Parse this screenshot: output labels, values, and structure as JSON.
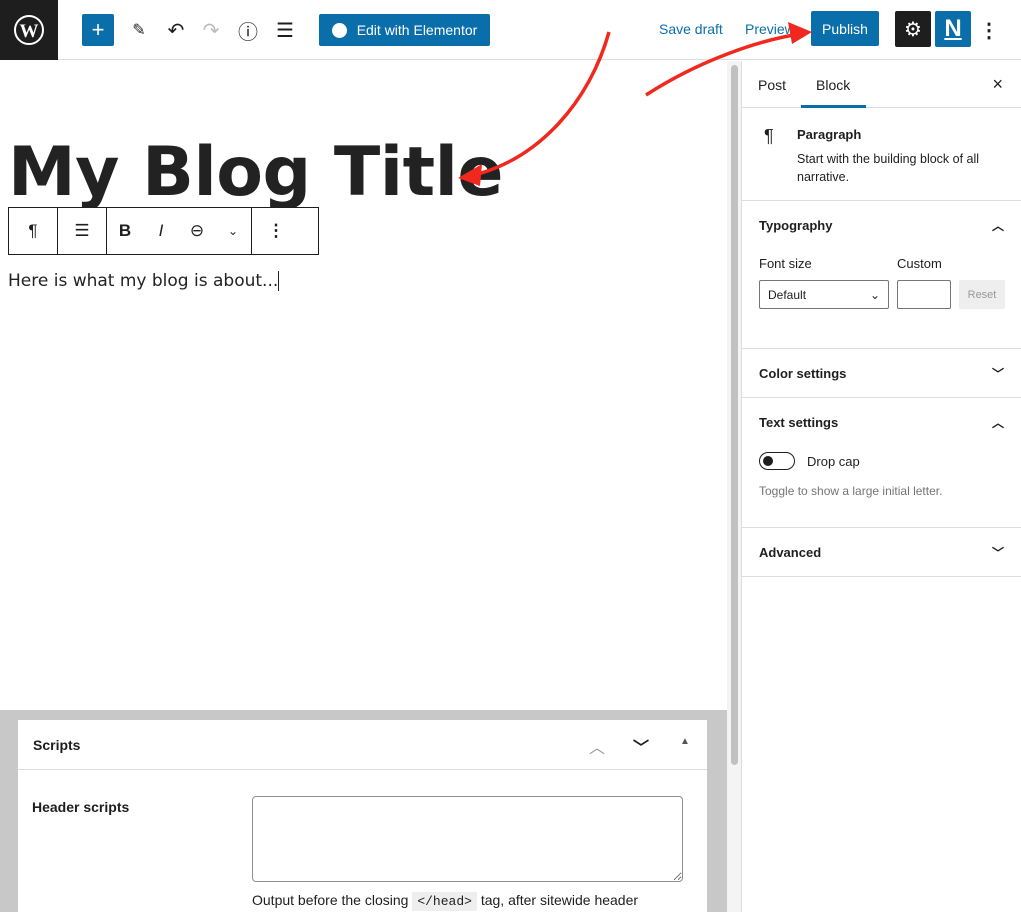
{
  "topbar": {
    "edit_elementor": "Edit with Elementor",
    "save_draft": "Save draft",
    "preview": "Preview",
    "publish": "Publish",
    "icons": [
      "wordpress-logo",
      "plus-icon",
      "pencil-icon",
      "undo-icon",
      "redo-icon",
      "info-icon",
      "list-view-icon",
      "elementor-icon",
      "gear-icon",
      "n-plugin-icon",
      "more-vertical-icon"
    ]
  },
  "editor": {
    "title": "My Blog Title",
    "paragraph": "Here is what my blog is about..."
  },
  "sidebar": {
    "tabs": [
      "Post",
      "Block"
    ],
    "active_tab": "Block",
    "block": {
      "name": "Paragraph",
      "description": "Start with the building block of all narrative."
    },
    "typography": {
      "heading": "Typography",
      "font_size_label": "Font size",
      "custom_label": "Custom",
      "font_size_value": "Default",
      "custom_value": "",
      "reset": "Reset"
    },
    "color_settings": "Color settings",
    "text_settings": {
      "heading": "Text settings",
      "drop_cap": "Drop cap",
      "drop_cap_on": false,
      "help": "Toggle to show a large initial letter."
    },
    "advanced": "Advanced"
  },
  "meta": {
    "title": "Scripts",
    "header_label": "Header scripts",
    "header_value": "",
    "help_before": "Output before the closing",
    "help_code": "</head>",
    "help_after": "tag, after sitewide header"
  },
  "colors": {
    "accent": "#0a6eab",
    "dark": "#1e1e1e",
    "annotation": "#f0281e"
  }
}
